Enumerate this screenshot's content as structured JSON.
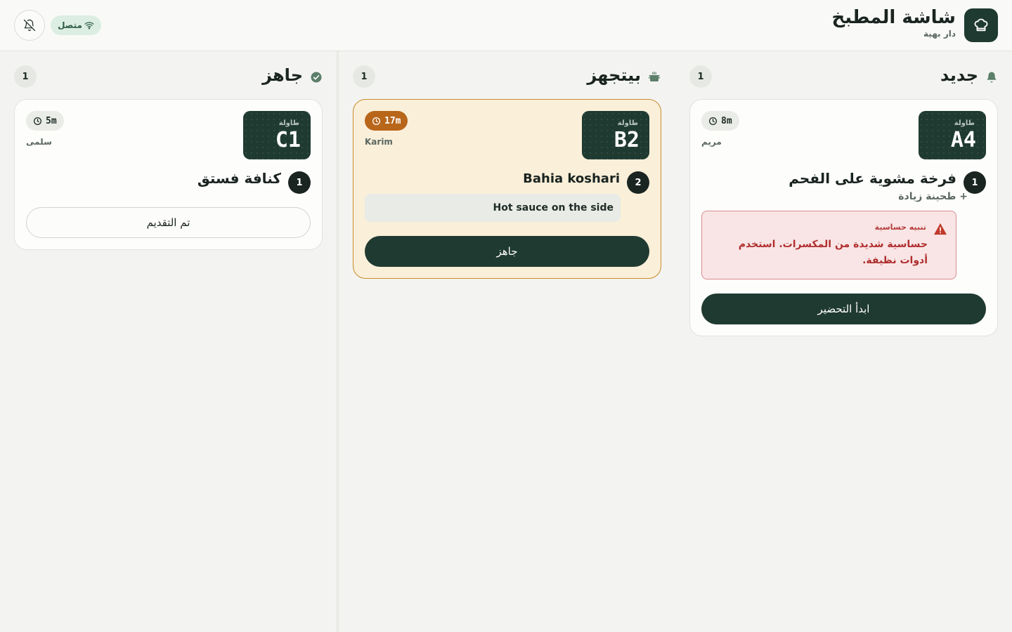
{
  "header": {
    "title": "شاشة المطبخ",
    "subtitle": "دار بهية",
    "connection_status": "متصل",
    "brand_icon": "chef-hat-icon",
    "bell_icon": "bell-off-icon",
    "wifi_icon": "wifi-icon"
  },
  "columns": {
    "new": {
      "title": "جديد",
      "icon": "bell-icon",
      "count": "1",
      "card": {
        "table_label": "طاولة",
        "table_code": "A4",
        "elapsed": "8m",
        "server": "مريم",
        "quantity": "1",
        "item": "فرخة مشوية على الفحم",
        "modifier": "+ طحينة زيادة",
        "allergy_title": "تنبيه حساسية",
        "allergy_text": "حساسية شديدة من المكسرات. استخدم أدوات نظيفة.",
        "action": "ابدأ التحضير"
      }
    },
    "preparing": {
      "title": "بيتجهز",
      "icon": "cooking-pot-icon",
      "count": "1",
      "card": {
        "table_label": "طاولة",
        "table_code": "B2",
        "elapsed": "17m",
        "server": "Karim",
        "quantity": "2",
        "item": "Bahia koshari",
        "note": "Hot sauce on the side",
        "action": "جاهز"
      }
    },
    "ready": {
      "title": "جاهز",
      "icon": "check-circle-icon",
      "count": "1",
      "card": {
        "table_label": "طاولة",
        "table_code": "C1",
        "elapsed": "5m",
        "server": "سلمى",
        "quantity": "1",
        "item": "كنافة فستق",
        "action": "تم التقديم"
      }
    }
  },
  "colors": {
    "primary": "#1f3a31",
    "preparing_card": "#faefd9",
    "timer_warning": "#b8661a",
    "allergy_text": "#b02e2e",
    "online_pill": "#dceee3"
  }
}
